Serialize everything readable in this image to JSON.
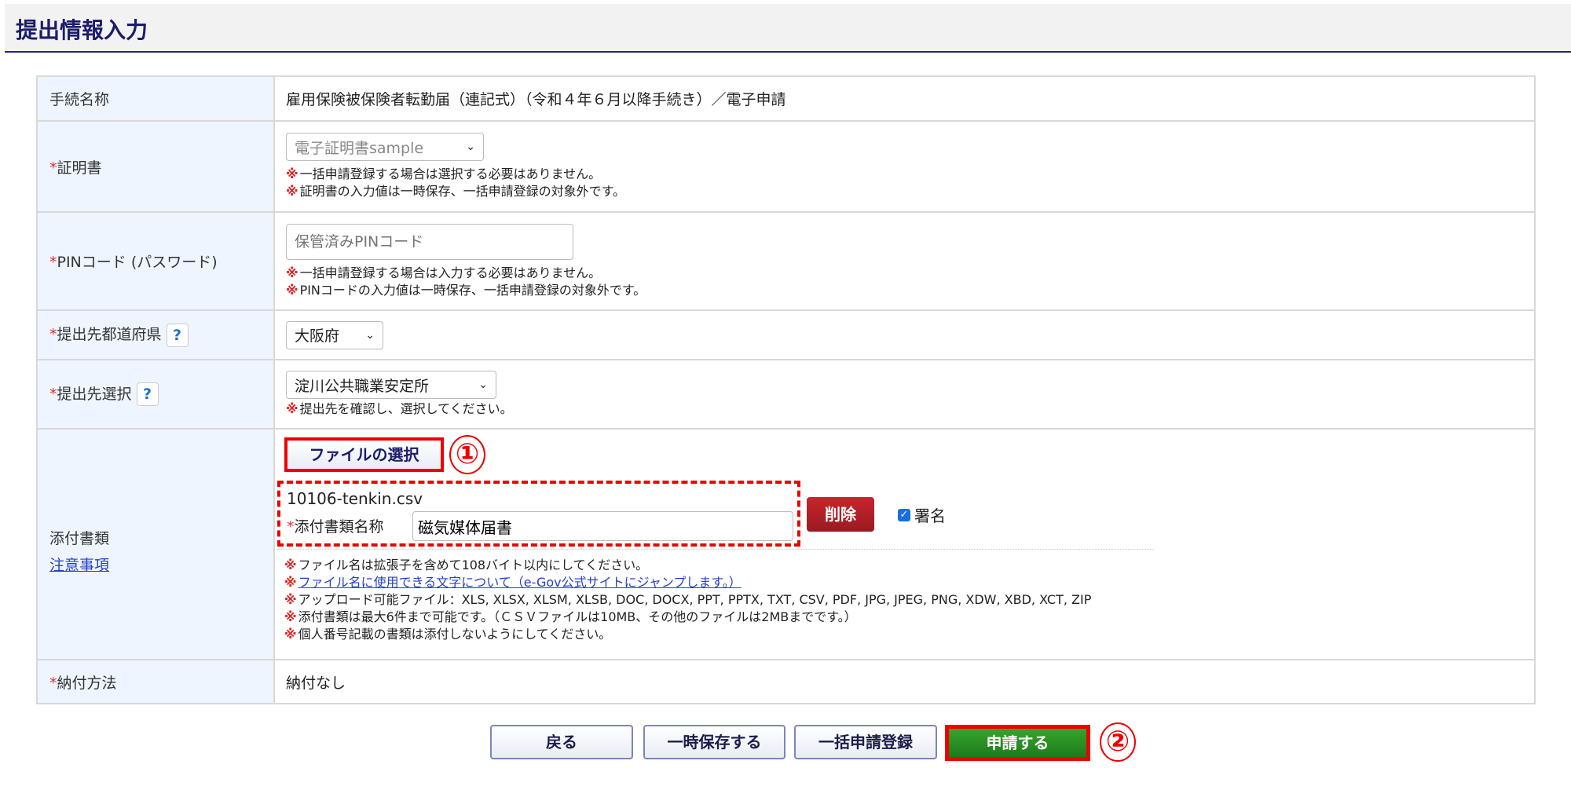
{
  "header": {
    "title": "提出情報入力"
  },
  "rows": {
    "procedure": {
      "label": "手続名称",
      "value": "雇用保険被保険者転勤届（連記式）（令和４年６月以降手続き）／電子申請"
    },
    "certificate": {
      "req": "*",
      "label": "証明書",
      "selected": "電子証明書sample",
      "notes": [
        "一括申請登録する場合は選択する必要はありません。",
        "証明書の入力値は一時保存、一括申請登録の対象外です。"
      ]
    },
    "pin": {
      "req": "*",
      "label": "PINコード (パスワード)",
      "placeholder": "保管済みPINコード",
      "notes": [
        "一括申請登録する場合は入力する必要はありません。",
        "PINコードの入力値は一時保存、一括申請登録の対象外です。"
      ]
    },
    "prefecture": {
      "req": "*",
      "label": "提出先都道府県",
      "help": "?",
      "selected": "大阪府"
    },
    "office": {
      "req": "*",
      "label": "提出先選択",
      "help": "?",
      "selected": "淀川公共職業安定所",
      "notes": [
        "提出先を確認し、選択してください。"
      ]
    },
    "attachment": {
      "label": "添付書類",
      "link": "注意事項",
      "choose_button": "ファイルの選択",
      "marker1": "①",
      "filename": "10106-tenkin.csv",
      "name_req": "*",
      "name_label": "添付書類名称",
      "name_value": "磁気媒体届書",
      "delete_button": "削除",
      "sign_label": "署名",
      "sign_checked": true,
      "notes": [
        "ファイル名は拡張子を含めて108バイト以内にしてください。",
        "ファイル名に使用できる文字について（e-Gov公式サイトにジャンプします。）",
        "アップロード可能ファイル：XLS, XLSX, XLSM, XLSB, DOC, DOCX, PPT, PPTX, TXT, CSV, PDF, JPG, JPEG, PNG, XDW, XBD, XCT, ZIP",
        "添付書類は最大6件まで可能です。（ＣＳＶファイルは10MB、その他のファイルは2MBまでです。）",
        "個人番号記載の書類は添付しないようにしてください。"
      ]
    },
    "payment": {
      "req": "*",
      "label": "納付方法",
      "value": "納付なし"
    }
  },
  "note_mark": "※",
  "buttons": {
    "back": "戻る",
    "save": "一時保存する",
    "bulk": "一括申請登録",
    "apply": "申請する",
    "marker2": "②"
  },
  "colors": {
    "accent": "#23237a",
    "apply": "#2e8b2e",
    "delete": "#b0202a",
    "highlight": "#ee0000"
  }
}
